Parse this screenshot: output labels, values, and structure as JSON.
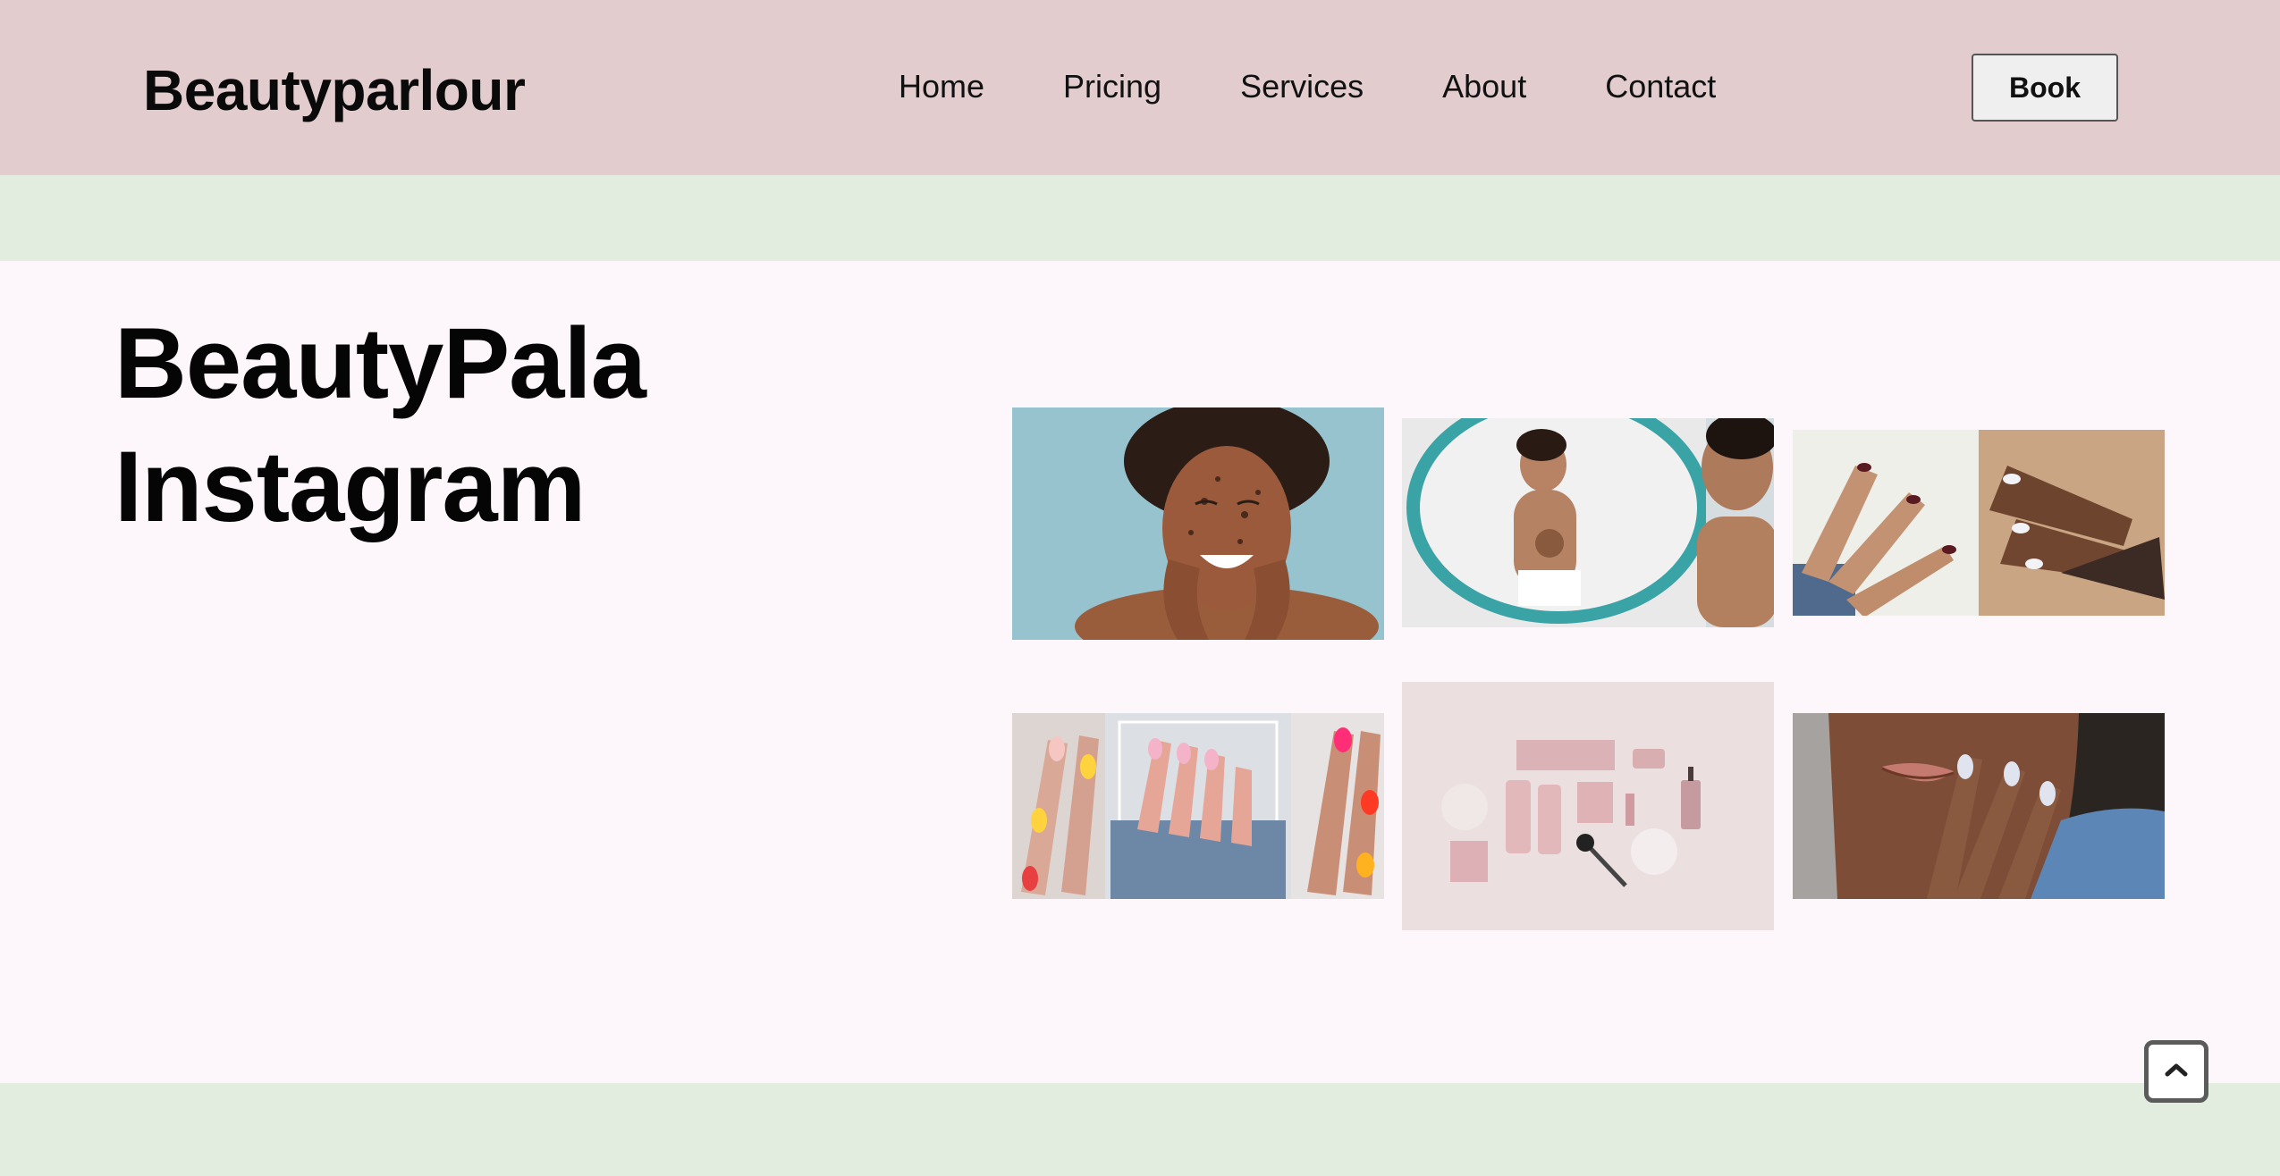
{
  "header": {
    "logo": "Beautyparlour",
    "nav": [
      "Home",
      "Pricing",
      "Services",
      "About",
      "Contact"
    ],
    "book_label": "Book"
  },
  "instagram": {
    "title_line1": "BeautyPala",
    "title_line2": "Instagram",
    "photos": [
      {
        "name": "woman-face-scrub-photo"
      },
      {
        "name": "woman-mirror-scrub-photo"
      },
      {
        "name": "manicure-hands-photo"
      },
      {
        "name": "colorful-nail-art-photo"
      },
      {
        "name": "pink-cosmetics-flatlay-photo"
      },
      {
        "name": "woman-white-nails-face-photo"
      }
    ]
  },
  "colors": {
    "header_bg": "#e2cccd",
    "band_bg": "#e3eddf",
    "section_bg": "#fdf7fc"
  },
  "icons": {
    "scroll_top": "chevron-up-icon"
  }
}
